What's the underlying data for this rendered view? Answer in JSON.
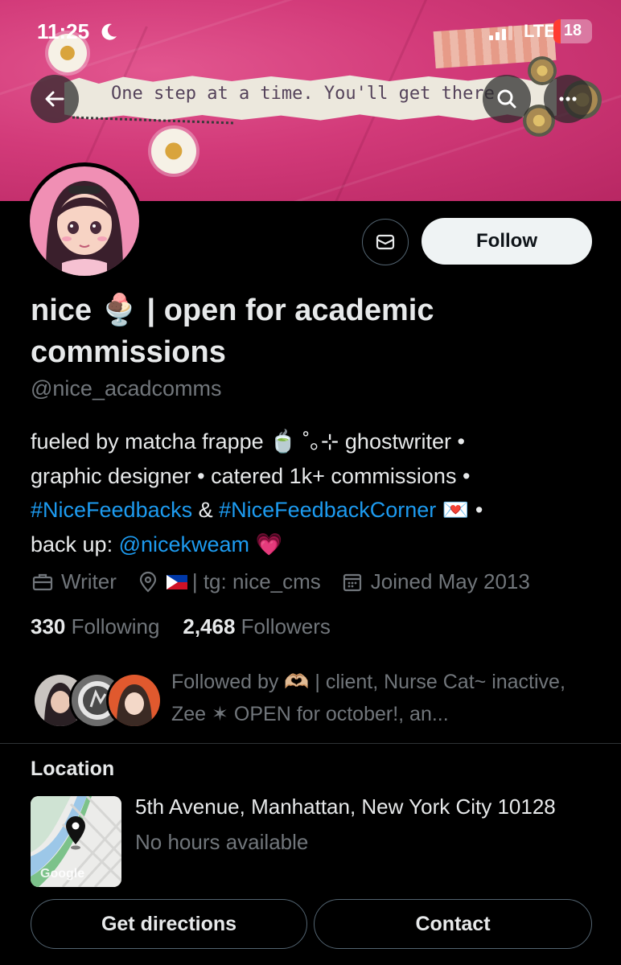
{
  "status_bar": {
    "time": "11:25",
    "network": "LTE",
    "battery": "18",
    "battery_level": 0.18
  },
  "banner": {
    "quote": "One step at a time. You'll get there."
  },
  "header": {
    "back_icon": "arrow-left-icon",
    "search_icon": "search-icon",
    "more_icon": "ellipsis-icon"
  },
  "actions": {
    "message_icon": "envelope-icon",
    "follow_label": "Follow"
  },
  "profile": {
    "name_part1": "nice",
    "name_emoji": "🍨",
    "name_part2": "| open for academic commissions",
    "handle": "@nice_acadcomms",
    "bio": {
      "line1": "fueled by matcha frappe 🍵 ˚｡⊹ ghostwriter •",
      "line2": "graphic designer • catered 1k+ commissions •",
      "hashtag1": "#NiceFeedbacks",
      "amp": " & ",
      "hashtag2": "#NiceFeedbackCorner",
      "line3_end": " 💌 •",
      "line4_start": "back up: ",
      "mention": "@nicekweam",
      "line4_end": " 💗"
    },
    "meta": {
      "profession": "Writer",
      "location_text": "| tg: nice_cms",
      "joined": "Joined May 2013"
    },
    "stats": {
      "following_count": "330",
      "following_label": "Following",
      "followers_count": "2,468",
      "followers_label": "Followers"
    },
    "followed_by": "Followed by 🫶🏼 | client, Nurse Cat~ inactive, Zee ✶ OPEN for october!, an..."
  },
  "location_card": {
    "title": "Location",
    "address": "5th Avenue, Manhattan, New York City  10128",
    "hours": "No hours available",
    "map_label": "Google"
  },
  "buttons": {
    "directions": "Get directions",
    "contact": "Contact"
  }
}
